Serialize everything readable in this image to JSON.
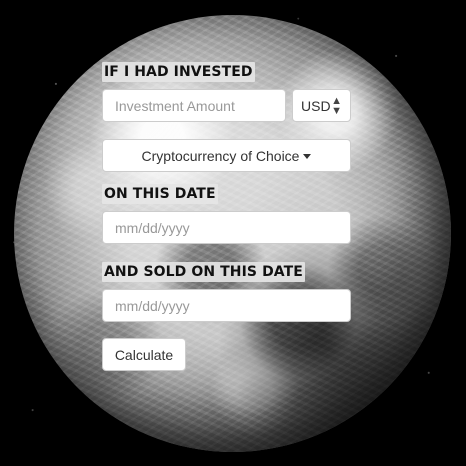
{
  "form": {
    "invested_label": "IF I HAD INVESTED",
    "amount": {
      "placeholder": "Investment Amount",
      "value": ""
    },
    "currency": {
      "selected": "USD",
      "icon": "up-down-icon"
    },
    "crypto_dropdown": {
      "label": "Cryptocurrency of Choice",
      "icon": "caret-down-icon"
    },
    "buy_date_label": "ON THIS DATE",
    "buy_date": {
      "placeholder": "mm/dd/yyyy",
      "value": ""
    },
    "sell_date_label": "AND SOLD ON THIS DATE",
    "sell_date": {
      "placeholder": "mm/dd/yyyy",
      "value": ""
    },
    "calculate_label": "Calculate"
  }
}
